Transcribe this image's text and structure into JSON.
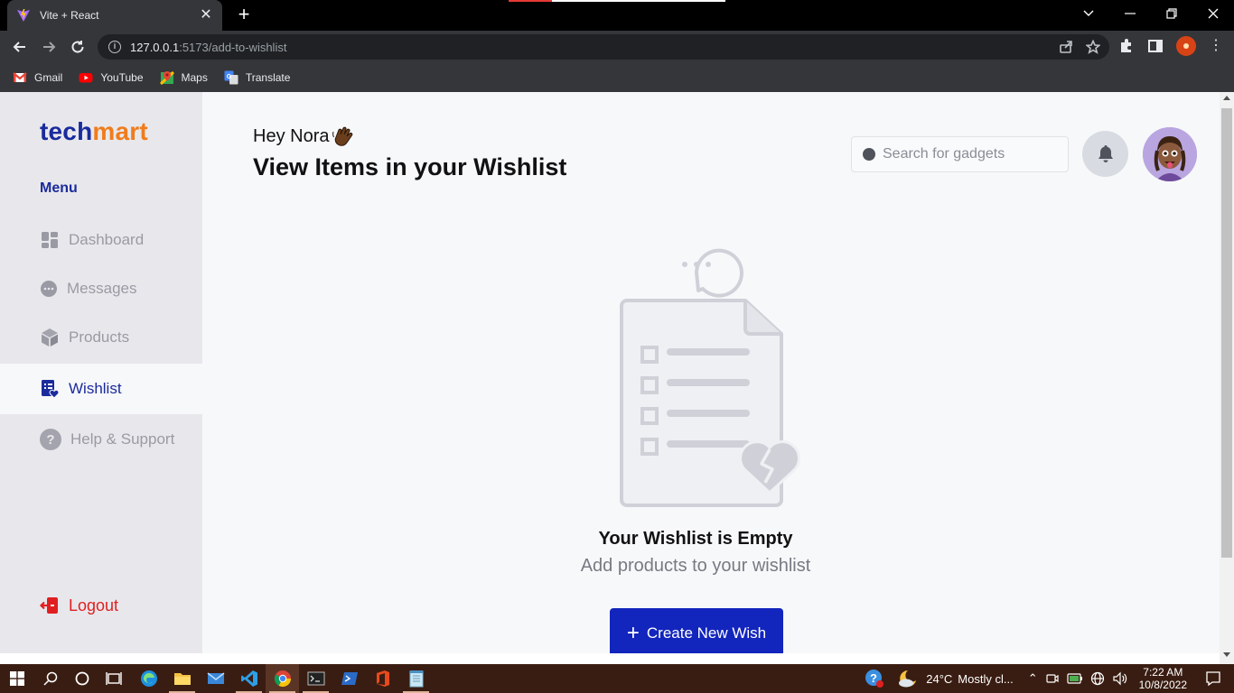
{
  "browser": {
    "tab_title": "Vite + React",
    "url_host": "127.0.0.1",
    "url_path": ":5173/add-to-wishlist",
    "bookmarks": [
      {
        "label": "Gmail",
        "icon": "gmail-icon"
      },
      {
        "label": "YouTube",
        "icon": "youtube-icon"
      },
      {
        "label": "Maps",
        "icon": "maps-icon"
      },
      {
        "label": "Translate",
        "icon": "translate-icon"
      }
    ]
  },
  "brand": {
    "part1": "tech",
    "part2": "mart",
    "color_primary": "#1a2b9c",
    "color_accent": "#f07c1c"
  },
  "sidebar": {
    "menu_label": "Menu",
    "items": [
      {
        "label": "Dashboard",
        "icon": "dashboard-icon",
        "active": false
      },
      {
        "label": "Messages",
        "icon": "messages-icon",
        "active": false
      },
      {
        "label": "Products",
        "icon": "products-icon",
        "active": false
      },
      {
        "label": "Wishlist",
        "icon": "wishlist-icon",
        "active": true
      },
      {
        "label": "Help & Support",
        "icon": "help-icon",
        "active": false
      }
    ],
    "logout_label": "Logout"
  },
  "header": {
    "greeting": "Hey Nora",
    "title": "View Items in your Wishlist",
    "search_placeholder": "Search for gadgets"
  },
  "empty_state": {
    "title": "Your Wishlist is Empty",
    "subtitle": "Add products to your wishlist",
    "button_label": "Create New Wish",
    "button_color": "#1225bd"
  },
  "taskbar": {
    "weather_temp": "24°C",
    "weather_text": "Mostly cl...",
    "time": "7:22 AM",
    "date": "10/8/2022"
  }
}
